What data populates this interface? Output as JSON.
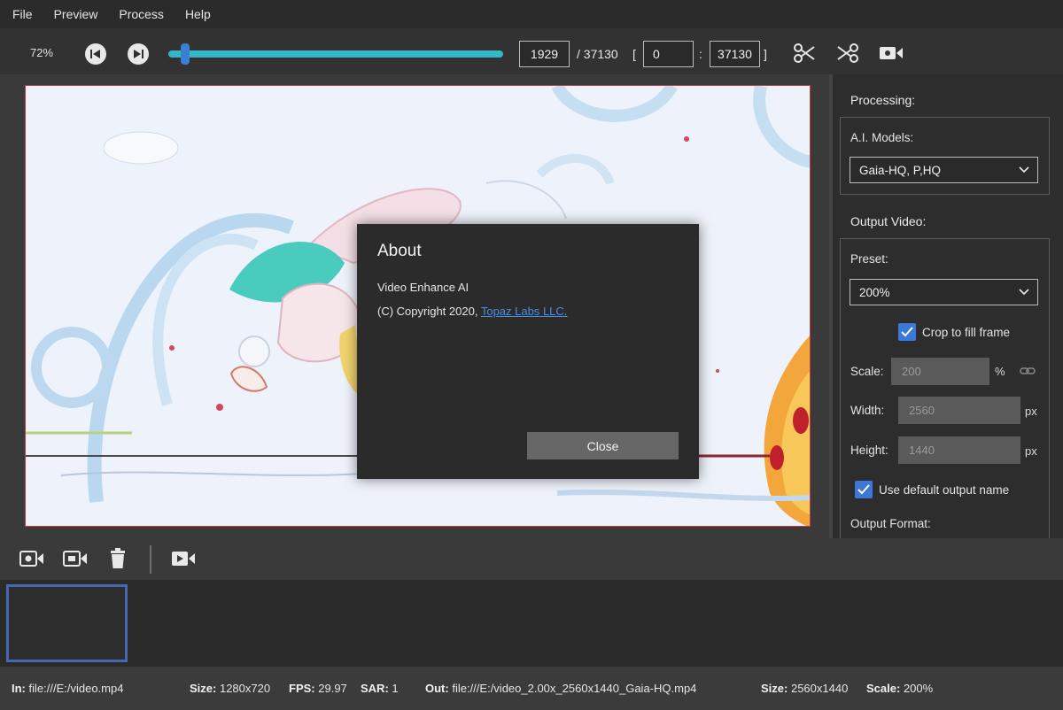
{
  "menu": [
    "File",
    "Preview",
    "Process",
    "Help"
  ],
  "toolbar": {
    "zoom": "72%",
    "current_frame": "1929",
    "total_frames": "/ 37130",
    "bracket_open": "[",
    "range_start": "0",
    "range_sep": ":",
    "range_end": "37130",
    "bracket_close": "]",
    "playback_progress": 0.05
  },
  "about": {
    "title": "About",
    "product": "Video Enhance AI",
    "copyright_prefix": "(C) Copyright 2020,",
    "company_link": "Topaz Labs LLC.",
    "close_label": "Close"
  },
  "panel": {
    "processing_heading": "Processing:",
    "ai_models_label": "A.I. Models:",
    "ai_model_value": "Gaia-HQ, P,HQ",
    "output_heading": "Output Video:",
    "preset_label": "Preset:",
    "preset_value": "200%",
    "crop_label": "Crop to fill frame",
    "scale_label": "Scale:",
    "scale_value": "200",
    "scale_unit": "%",
    "width_label": "Width:",
    "width_value": "2560",
    "width_unit": "px",
    "height_label": "Height:",
    "height_value": "1440",
    "height_unit": "px",
    "default_name_label": "Use default output name",
    "output_format_label": "Output Format:"
  },
  "status": {
    "in_label": "In:",
    "in_value": "file:///E:/video.mp4",
    "size_label": "Size:",
    "size_value": "1280x720",
    "fps_label": "FPS:",
    "fps_value": "29.97",
    "sar_label": "SAR:",
    "sar_value": "1",
    "out_label": "Out:",
    "out_value": "file:///E:/video_2.00x_2560x1440_Gaia-HQ.mp4",
    "out_size_label": "Size:",
    "out_size_value": "2560x1440",
    "scale_label": "Scale:",
    "scale_value": "200%"
  },
  "colors": {
    "accent": "#32b8c6",
    "thumb_handle": "#3a7fd0",
    "checkbox": "#3c78d8",
    "link": "#4a8de6"
  }
}
